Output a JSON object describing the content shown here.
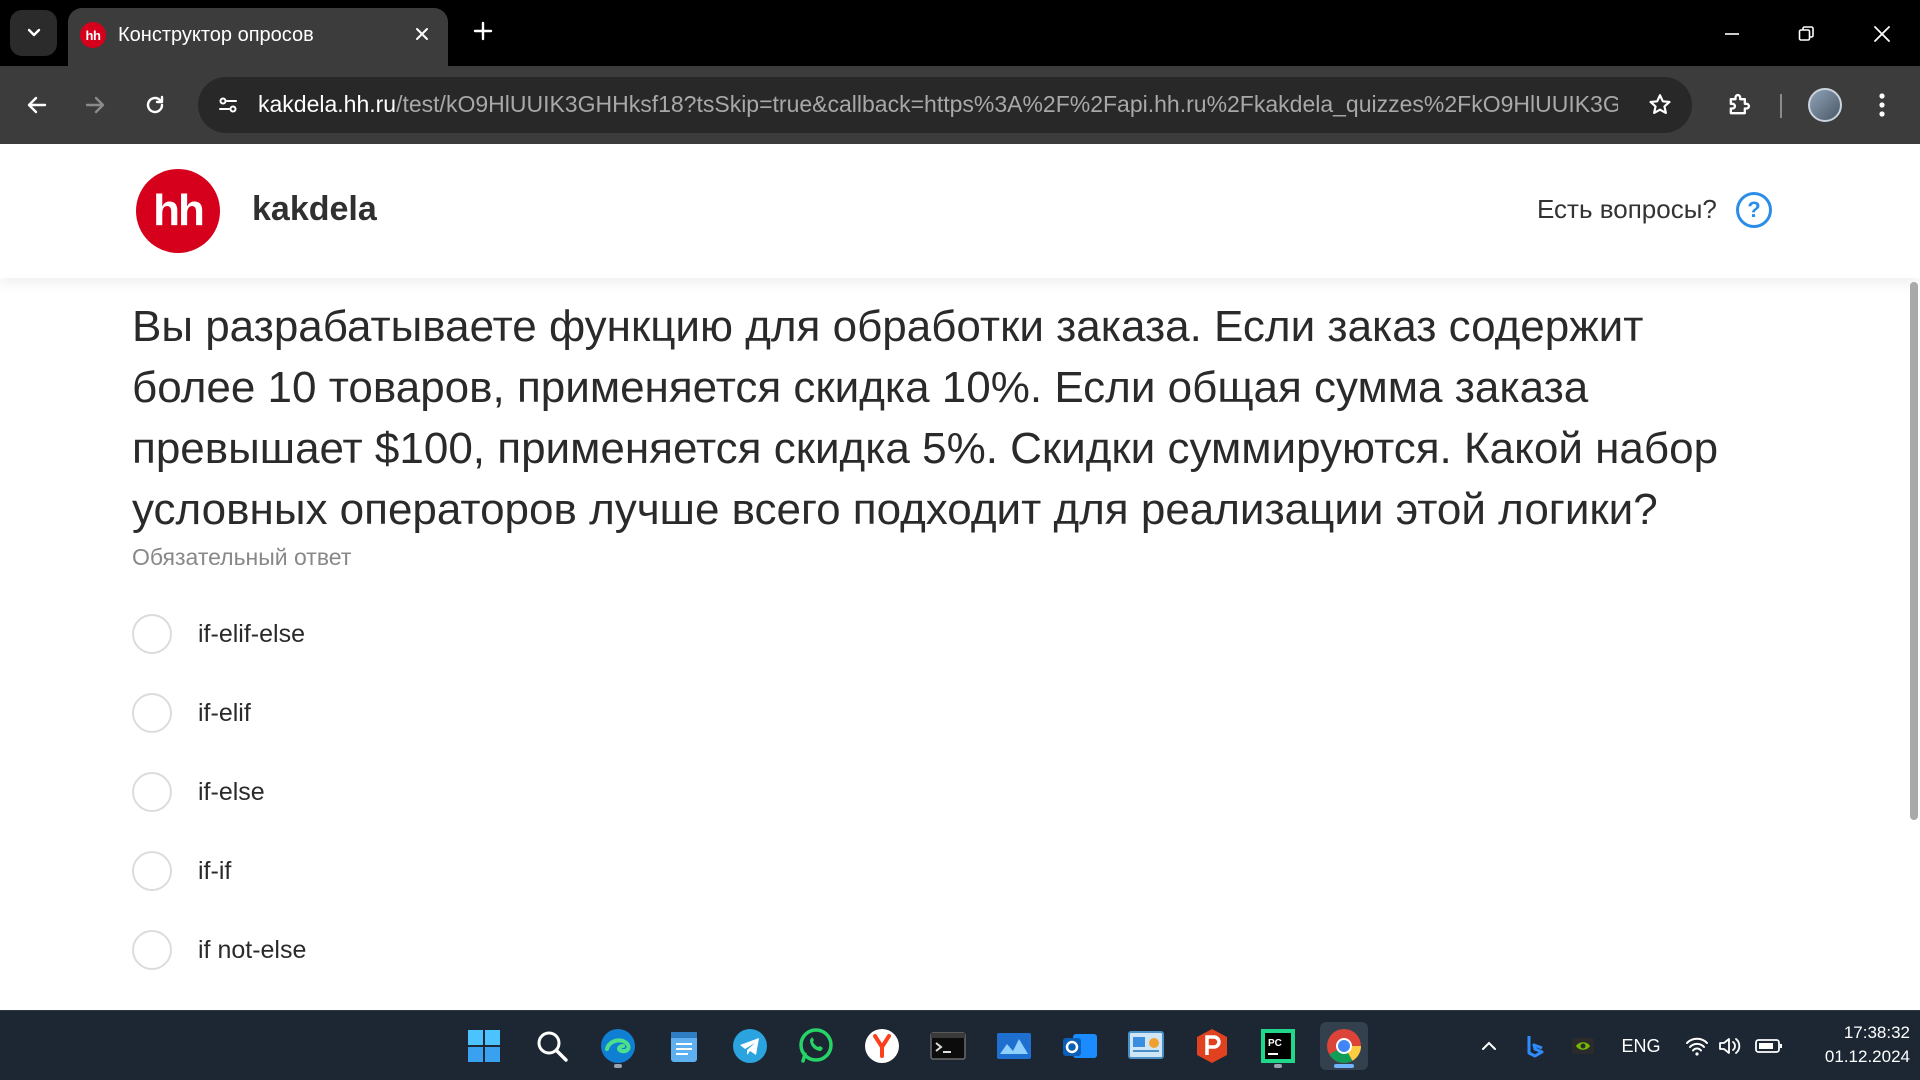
{
  "browser": {
    "tab_title": "Конструктор опросов",
    "favicon_text": "hh",
    "url_host": "kakdela.hh.ru",
    "url_path": "/test/kO9HlUUIK3GHHksf18?tsSkip=true&callback=https%3A%2F%2Fapi.hh.ru%2Fkakdela_quizzes%2FkO9HlUUIK3GH..."
  },
  "header": {
    "logo_text": "hh",
    "brand": "kakdela",
    "help_text": "Есть вопросы?",
    "help_icon_glyph": "?"
  },
  "quiz": {
    "question": "Вы разрабатываете функцию для обработки заказа. Если заказ содержит более 10 товаров, применяется скидка 10%. Если общая сумма заказа превышает $100, применяется скидка 5%. Скидки суммируются. Какой набор условных операторов лучше всего подходит для реализации этой логики?",
    "required_note": "Обязательный ответ",
    "options": [
      {
        "label": "if-elif-else",
        "selected": false
      },
      {
        "label": "if-elif",
        "selected": false
      },
      {
        "label": "if-else",
        "selected": false
      },
      {
        "label": "if-if",
        "selected": false
      },
      {
        "label": "if not-else",
        "selected": false
      }
    ]
  },
  "taskbar": {
    "apps": [
      "start-icon",
      "search-icon",
      "edge-icon",
      "notepad-icon",
      "telegram-icon",
      "whatsapp-icon",
      "yandex-browser-icon",
      "terminal-icon",
      "monitor-app-icon",
      "outlook-icon",
      "control-panel-icon",
      "psiphon-icon",
      "pycharm-icon",
      "chrome-icon"
    ],
    "active_app": "chrome-icon",
    "language": "ENG",
    "time": "17:38:32",
    "date": "01.12.2024"
  },
  "colors": {
    "brand_red": "#d6001c",
    "help_blue": "#2b8de8",
    "chrome_dark": "#3c3c3c",
    "taskbar_bg": "#1c2733"
  }
}
